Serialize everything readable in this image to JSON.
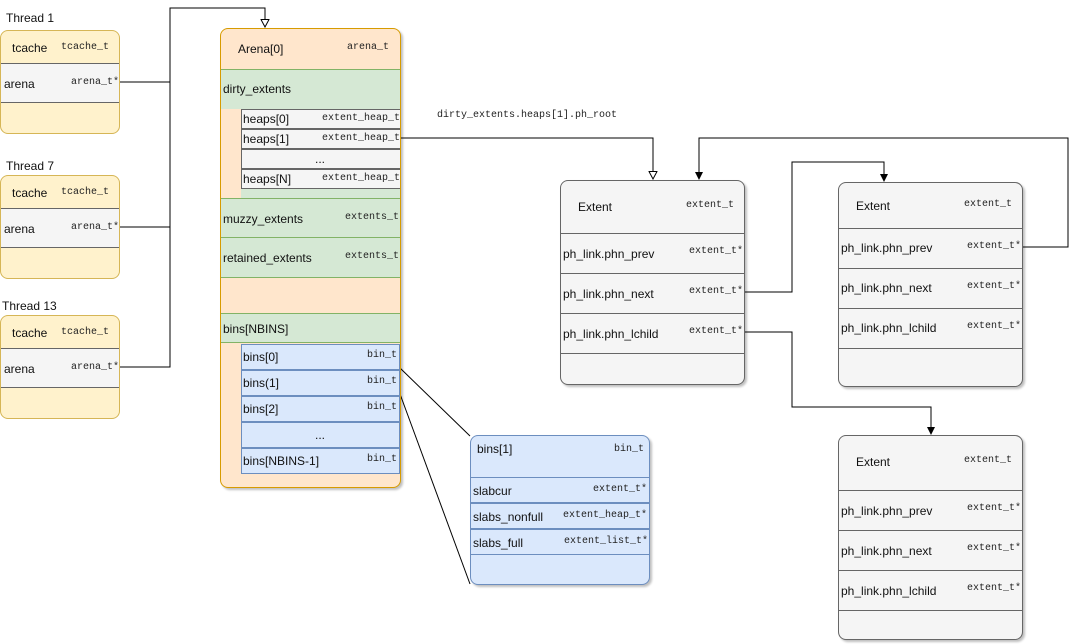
{
  "threads": [
    {
      "title": "Thread 1",
      "tcache_label": "tcache",
      "tcache_type": "tcache_t",
      "arena_label": "arena",
      "arena_type": "arena_t*"
    },
    {
      "title": "Thread 7",
      "tcache_label": "tcache",
      "tcache_type": "tcache_t",
      "arena_label": "arena",
      "arena_type": "arena_t*"
    },
    {
      "title": "Thread 13",
      "tcache_label": "tcache",
      "tcache_type": "tcache_t",
      "arena_label": "arena",
      "arena_type": "arena_t*"
    }
  ],
  "arena": {
    "title": "Arena[0]",
    "type": "arena_t",
    "dirty": "dirty_extents",
    "heaps": [
      {
        "label": "heaps[0]",
        "type": "extent_heap_t"
      },
      {
        "label": "heaps[1]",
        "type": "extent_heap_t"
      },
      {
        "label": "...",
        "type": ""
      },
      {
        "label": "heaps[N]",
        "type": "extent_heap_t"
      }
    ],
    "muzzy": {
      "label": "muzzy_extents",
      "type": "extents_t"
    },
    "retained": {
      "label": "retained_extents",
      "type": "extents_t"
    },
    "bins_header": "bins[NBINS]",
    "bins": [
      {
        "label": "bins[0]",
        "type": "bin_t"
      },
      {
        "label": "bins(1]",
        "type": "bin_t"
      },
      {
        "label": "bins[2]",
        "type": "bin_t"
      },
      {
        "label": "...",
        "type": ""
      },
      {
        "label": "bins[NBINS-1]",
        "type": "bin_t"
      }
    ]
  },
  "bin_detail": {
    "title": "bins[1]",
    "type": "bin_t",
    "fields": [
      {
        "label": "slabcur",
        "type": "extent_t*"
      },
      {
        "label": "slabs_nonfull",
        "type": "extent_heap_t*"
      },
      {
        "label": "slabs_full",
        "type": "extent_list_t*"
      }
    ]
  },
  "edge_label": "dirty_extents.heaps[1].ph_root",
  "extents": [
    {
      "title": "Extent",
      "type": "extent_t",
      "fields": [
        {
          "label": "ph_link.phn_prev",
          "type": "extent_t*"
        },
        {
          "label": "ph_link.phn_next",
          "type": "extent_t*"
        },
        {
          "label": "ph_link.phn_lchild",
          "type": "extent_t*"
        }
      ]
    },
    {
      "title": "Extent",
      "type": "extent_t",
      "fields": [
        {
          "label": "ph_link.phn_prev",
          "type": "extent_t*"
        },
        {
          "label": "ph_link.phn_next",
          "type": "extent_t*"
        },
        {
          "label": "ph_link.phn_lchild",
          "type": "extent_t*"
        }
      ]
    },
    {
      "title": "Extent",
      "type": "extent_t",
      "fields": [
        {
          "label": "ph_link.phn_prev",
          "type": "extent_t*"
        },
        {
          "label": "ph_link.phn_next",
          "type": "extent_t*"
        },
        {
          "label": "ph_link.phn_lchild",
          "type": "extent_t*"
        }
      ]
    }
  ]
}
